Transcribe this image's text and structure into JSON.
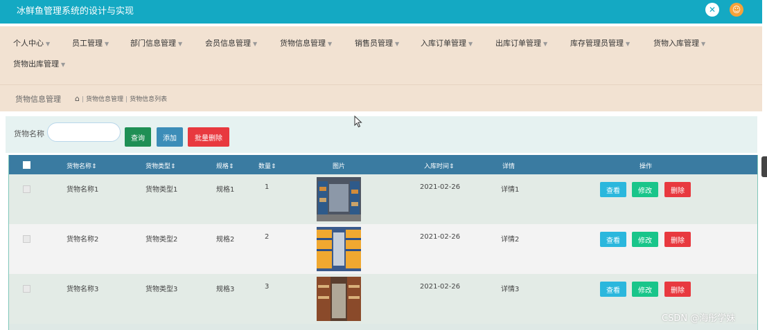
{
  "header": {
    "app_title": "冰鲜鱼管理系统的设计与实现",
    "expand_icon": "expand-icon",
    "user_icon": "user-avatar-icon",
    "accent": "#14a9c3"
  },
  "nav": {
    "items": [
      {
        "label": "个人中心"
      },
      {
        "label": "员工管理"
      },
      {
        "label": "部门信息管理"
      },
      {
        "label": "会员信息管理"
      },
      {
        "label": "货物信息管理"
      },
      {
        "label": "销售员管理"
      },
      {
        "label": "入库订单管理"
      },
      {
        "label": "出库订单管理"
      },
      {
        "label": "库存管理员管理"
      },
      {
        "label": "货物入库管理"
      },
      {
        "label": "货物出库管理"
      }
    ]
  },
  "breadcrumb": {
    "title": "货物信息管理",
    "path_1": "货物信息管理",
    "path_2": "货物信息列表"
  },
  "search": {
    "label": "货物名称",
    "value": "",
    "search_button": "查询",
    "add_button": "添加",
    "batch_delete_button": "批量删除"
  },
  "table": {
    "headers": {
      "name": "货物名称",
      "type": "货物类型",
      "spec": "规格",
      "qty": "数量",
      "image": "图片",
      "date": "入库时间",
      "detail": "详情",
      "action": "操作"
    },
    "rows": [
      {
        "name": "货物名称1",
        "type": "货物类型1",
        "spec": "规格1",
        "qty": "1",
        "date": "2021-02-26",
        "detail": "详情1"
      },
      {
        "name": "货物名称2",
        "type": "货物类型2",
        "spec": "规格2",
        "qty": "2",
        "date": "2021-02-26",
        "detail": "详情2"
      },
      {
        "name": "货物名称3",
        "type": "货物类型3",
        "spec": "规格3",
        "qty": "3",
        "date": "2021-02-26",
        "detail": "详情3"
      }
    ],
    "view_label": "查看",
    "edit_label": "修改",
    "delete_label": "删除"
  },
  "watermark": "CSDN @海彤学妹"
}
